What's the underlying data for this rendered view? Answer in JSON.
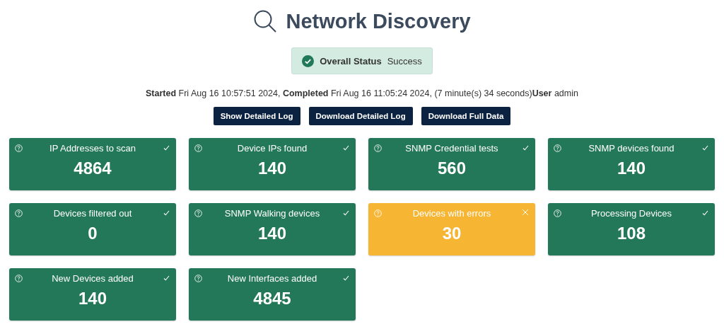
{
  "title": "Network Discovery",
  "overall_status": {
    "label": "Overall Status",
    "value": "Success",
    "error": false
  },
  "run_info": "**Started** Fri Aug 16 10:57:51 2024, **Completed** Fri Aug 16 11:05:24 2024, (7 minute(s) 34 seconds)**User** admin",
  "buttons": [
    "Show Detailed Log",
    "Download Detailed Log",
    "Download Full Data"
  ],
  "cards": [
    {
      "label": "IP Addresses to scan",
      "value": "4864",
      "error": false
    },
    {
      "label": "Device IPs found",
      "value": "140",
      "error": false
    },
    {
      "label": "SNMP Credential tests",
      "value": "560",
      "error": false
    },
    {
      "label": "SNMP devices found",
      "value": "140",
      "error": false
    },
    {
      "label": "Devices filtered out",
      "value": "0",
      "error": false
    },
    {
      "label": "SNMP Walking devices",
      "value": "140",
      "error": false
    },
    {
      "label": "Devices with errors",
      "value": "30",
      "error": true
    },
    {
      "label": "Processing Devices",
      "value": "108",
      "error": false
    },
    {
      "label": "New Devices added",
      "value": "140",
      "error": false
    },
    {
      "label": "New Interfaces added",
      "value": "4845",
      "error": false
    }
  ]
}
